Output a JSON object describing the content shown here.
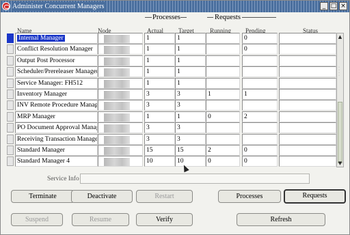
{
  "window": {
    "title": "Administer Concurrent Managers",
    "controls": [
      "_",
      "□",
      "×"
    ]
  },
  "groups": {
    "processes": "Processes",
    "requests": "Requests"
  },
  "columns": {
    "name": "Name",
    "node": "Node",
    "actual": "Actual",
    "target": "Target",
    "running": "Running",
    "pending": "Pending",
    "status": "Status"
  },
  "rows": [
    {
      "name": "Internal Manager",
      "actual": "1",
      "target": "1",
      "running": "",
      "pending": "0",
      "status": ""
    },
    {
      "name": "Conflict Resolution Manager",
      "actual": "1",
      "target": "1",
      "running": "",
      "pending": "0",
      "status": ""
    },
    {
      "name": "Output Post Processor",
      "actual": "1",
      "target": "1",
      "running": "",
      "pending": "",
      "status": ""
    },
    {
      "name": "Scheduler/Prereleaser Manager",
      "actual": "1",
      "target": "1",
      "running": "",
      "pending": "",
      "status": ""
    },
    {
      "name": "Service Manager: FH512",
      "actual": "1",
      "target": "1",
      "running": "",
      "pending": "",
      "status": ""
    },
    {
      "name": "Inventory Manager",
      "actual": "3",
      "target": "3",
      "running": "1",
      "pending": "1",
      "status": ""
    },
    {
      "name": "INV Remote Procedure Manager",
      "actual": "3",
      "target": "3",
      "running": "",
      "pending": "",
      "status": ""
    },
    {
      "name": "MRP Manager",
      "actual": "1",
      "target": "1",
      "running": "0",
      "pending": "2",
      "status": ""
    },
    {
      "name": "PO Document Approval Manager",
      "actual": "3",
      "target": "3",
      "running": "",
      "pending": "",
      "status": ""
    },
    {
      "name": "Receiving Transaction Manager",
      "actual": "3",
      "target": "3",
      "running": "",
      "pending": "",
      "status": ""
    },
    {
      "name": "Standard Manager",
      "actual": "15",
      "target": "15",
      "running": "2",
      "pending": "0",
      "status": ""
    },
    {
      "name": "Standard Manager 4",
      "actual": "10",
      "target": "10",
      "running": "0",
      "pending": "0",
      "status": ""
    }
  ],
  "service_info_label": "Service Info",
  "buttons": {
    "terminate": "Terminate",
    "deactivate": "Deactivate",
    "restart": "Restart",
    "processes": "Processes",
    "requests": "Requests",
    "suspend": "Suspend",
    "resume": "Resume",
    "verify": "Verify",
    "refresh": "Refresh"
  }
}
